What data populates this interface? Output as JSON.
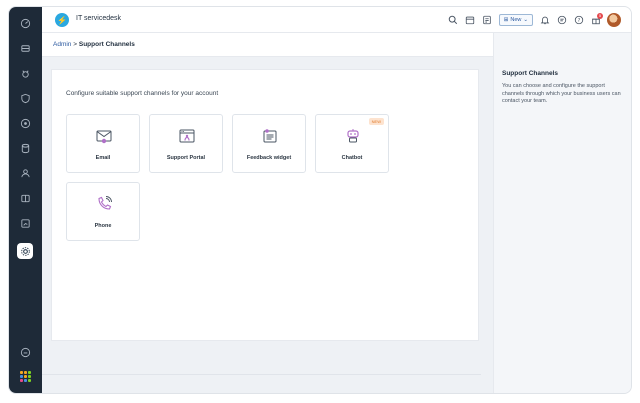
{
  "app": {
    "title": "IT servicedesk",
    "logo_glyph": "⚡"
  },
  "topbar": {
    "new_label": "New",
    "notification_count": "5"
  },
  "breadcrumb": {
    "parent": "Admin",
    "separator": " > ",
    "current": "Support Channels"
  },
  "main": {
    "intro": "Configure suitable support channels for your account",
    "channels": [
      {
        "label": "Email",
        "icon": "email-icon"
      },
      {
        "label": "Support Portal",
        "icon": "portal-icon"
      },
      {
        "label": "Feedback widget",
        "icon": "feedback-icon"
      },
      {
        "label": "Chatbot",
        "icon": "chatbot-icon",
        "badge": "NEW"
      },
      {
        "label": "Phone",
        "icon": "phone-icon"
      }
    ]
  },
  "sidebar": {
    "title": "Support Channels",
    "description": "You can choose and configure the support channels through which your business users can contact your team."
  },
  "colors": {
    "rail": "#1e2a38",
    "accent": "#2c5aa0",
    "brand": "#2aa8e0",
    "icon_purple": "#b070c8"
  }
}
